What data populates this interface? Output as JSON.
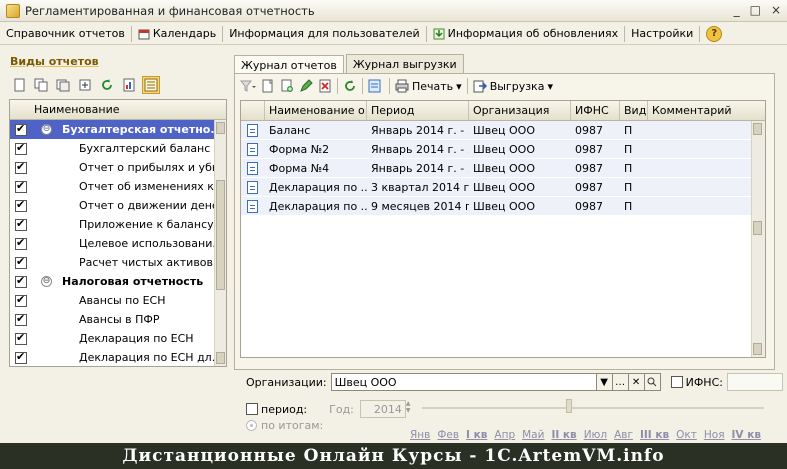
{
  "window": {
    "title": "Регламентированная и финансовая отчетность",
    "buttons": [
      "_",
      "□",
      "×"
    ]
  },
  "menubar": {
    "items": [
      {
        "label": "Справочник отчетов"
      },
      {
        "label": "Календарь"
      },
      {
        "label": "Информация для пользователей"
      },
      {
        "label": "Информация об обновлениях"
      },
      {
        "label": "Настройки"
      }
    ],
    "help": "?"
  },
  "left": {
    "title": "Виды отчетов",
    "column_header": "Наименование",
    "groups": [
      {
        "label": "Бухгалтерская отчетно...",
        "expander": "⊖",
        "selected": true,
        "children": [
          "Бухгалтерский баланс (...",
          "Отчет о прибылях и убы...",
          "Отчет об изменениях ка...",
          "Отчет о движении дене...",
          "Приложение к балансу (...",
          "Целевое использовани...",
          "Расчет чистых активов"
        ]
      },
      {
        "label": "Налоговая отчетность",
        "expander": "⊖",
        "selected": false,
        "children": [
          "Авансы по ЕСН",
          "Авансы в ПФР",
          "Декларация по ЕСН",
          "Декларация по ЕСН дл..."
        ]
      }
    ]
  },
  "right": {
    "tabs": [
      {
        "label": "Журнал отчетов",
        "active": true
      },
      {
        "label": "Журнал выгрузки",
        "active": false
      }
    ],
    "toolbar": {
      "print_label": "Печать",
      "export_label": "Выгрузка"
    },
    "columns": [
      "Наименование о...",
      "Период",
      "Организация",
      "ИФНС",
      "Вид",
      "Комментарий"
    ],
    "rows": [
      {
        "name": "Баланс",
        "period": "Январь 2014 г. - ...",
        "org": "Швец ООО",
        "ifns": "0987",
        "kind": "П",
        "comment": ""
      },
      {
        "name": "Форма №2",
        "period": "Январь 2014 г. - ...",
        "org": "Швец ООО",
        "ifns": "0987",
        "kind": "П",
        "comment": ""
      },
      {
        "name": "Форма №4",
        "period": "Январь 2014 г. - ...",
        "org": "Швец ООО",
        "ifns": "0987",
        "kind": "П",
        "comment": ""
      },
      {
        "name": "Декларация по ...",
        "period": "3 квартал 2014 г.",
        "org": "Швец ООО",
        "ifns": "0987",
        "kind": "П",
        "comment": ""
      },
      {
        "name": "Декларация по ...",
        "period": "9 месяцев 2014 г.",
        "org": "Швец ООО",
        "ifns": "0987",
        "kind": "П",
        "comment": ""
      }
    ]
  },
  "filters": {
    "org_label": "Организации:",
    "org_value": "Швец ООО",
    "ifns_label": "ИФНС:",
    "period_label": "период:",
    "year_label": "Год:",
    "year_value": "2014",
    "radio_label": "по итогам:",
    "months": [
      {
        "label": "Янв",
        "q": false
      },
      {
        "label": "Фев",
        "q": false
      },
      {
        "label": "I кв",
        "q": true
      },
      {
        "label": "Апр",
        "q": false
      },
      {
        "label": "Май",
        "q": false
      },
      {
        "label": "II кв",
        "q": true
      },
      {
        "label": "Июл",
        "q": false
      },
      {
        "label": "Авг",
        "q": false
      },
      {
        "label": "III кв",
        "q": true
      },
      {
        "label": "Окт",
        "q": false
      },
      {
        "label": "Ноя",
        "q": false
      },
      {
        "label": "IV кв",
        "q": true
      }
    ]
  },
  "banner": {
    "text": "Дистанционные Онлайн Курсы - 1C.ArtemVM.info"
  }
}
